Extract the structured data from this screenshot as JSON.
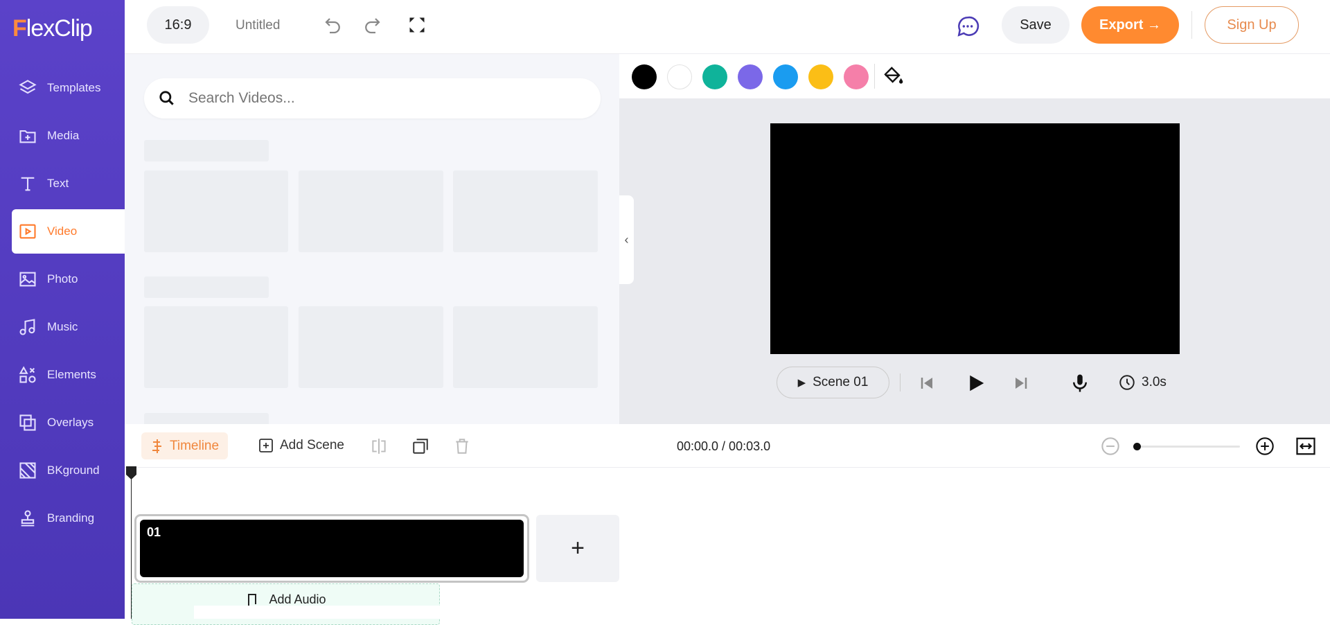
{
  "app": {
    "logo": "FlexClip"
  },
  "sidebar": {
    "items": [
      {
        "label": "Templates",
        "icon": "layers-icon"
      },
      {
        "label": "Media",
        "icon": "folder-plus-icon"
      },
      {
        "label": "Text",
        "icon": "text-icon"
      },
      {
        "label": "Video",
        "icon": "video-play-icon",
        "active": true
      },
      {
        "label": "Photo",
        "icon": "image-icon"
      },
      {
        "label": "Music",
        "icon": "music-icon"
      },
      {
        "label": "Elements",
        "icon": "shapes-icon"
      },
      {
        "label": "Overlays",
        "icon": "overlay-icon"
      },
      {
        "label": "BKground",
        "icon": "background-icon"
      },
      {
        "label": "Branding",
        "icon": "stamp-icon"
      }
    ]
  },
  "topbar": {
    "ratio": "16:9",
    "title": "Untitled",
    "save": "Save",
    "export": "Export →",
    "signup": "Sign Up"
  },
  "search": {
    "placeholder": "Search Videos..."
  },
  "colors": [
    "#000000",
    "#ffffff",
    "#0fb39a",
    "#7b68e8",
    "#1a9cf0",
    "#fbbe16",
    "#f57fa9"
  ],
  "player": {
    "scene": "Scene 01",
    "duration": "3.0s"
  },
  "timeline": {
    "label": "Timeline",
    "add_scene": "Add Scene",
    "time": "00:00.0 / 00:03.0",
    "scene_number": "01",
    "add_audio": "Add Audio",
    "zoom_level": 0
  },
  "accent": "#ff8a30",
  "brand": "#5641c6"
}
